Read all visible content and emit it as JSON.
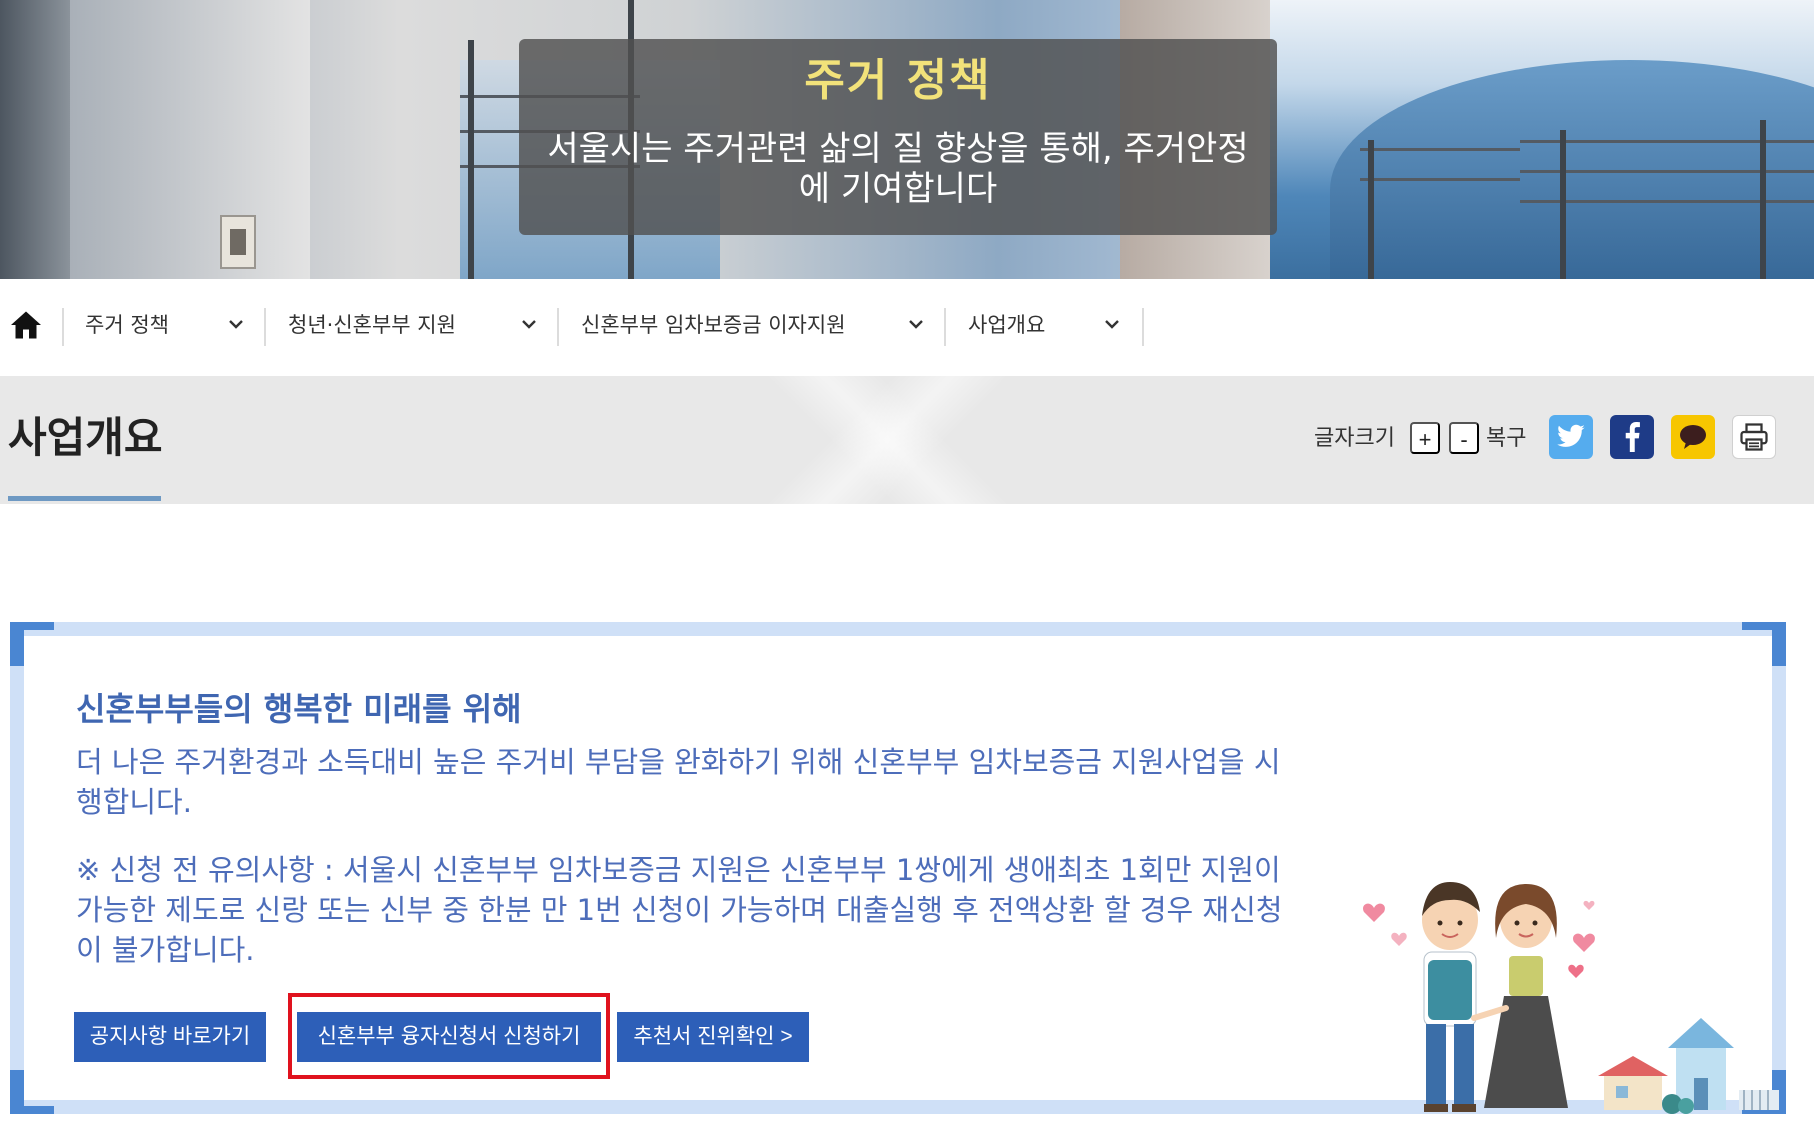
{
  "hero": {
    "title": "주거 정책",
    "description": "서울시는 주거관련 삶의 질 향상을 통해, 주거안정에 기여합니다"
  },
  "breadcrumb": {
    "home_icon": "home-icon",
    "items": [
      {
        "label": "주거 정책"
      },
      {
        "label": "청년·신혼부부 지원"
      },
      {
        "label": "신혼부부 임차보증금 이자지원"
      },
      {
        "label": "사업개요"
      }
    ]
  },
  "page": {
    "title": "사업개요"
  },
  "tools": {
    "font_size_label": "글자크기",
    "increase": "+",
    "decrease": "-",
    "reset": "복구",
    "share": [
      {
        "icon": "twitter-icon",
        "color": "#55acee"
      },
      {
        "icon": "facebook-icon",
        "color": "#1e3b87"
      },
      {
        "icon": "kakaotalk-icon",
        "color": "#f7c600"
      },
      {
        "icon": "print-icon",
        "color": "#ffffff"
      }
    ]
  },
  "content": {
    "heading": "신혼부부들의 행복한 미래를 위해",
    "body": "더 나은 주거환경과 소득대비 높은 주거비 부담을 완화하기 위해 신혼부부 임차보증금 지원사업을 시행합니다.",
    "notice": "※ 신청 전 유의사항 : 서울시 신혼부부 임차보증금 지원은 신혼부부 1쌍에게 생애최초 1회만 지원이 가능한 제도로 신랑 또는 신부 중 한분 만 1번 신청이 가능하며 대출실행 후 전액상환 할 경우 재신청이 불가합니다.",
    "buttons": {
      "notice_link": "공지사항 바로가기",
      "apply": "신혼부부 융자신청서 신청하기",
      "verify": "추천서 진위확인 >"
    }
  },
  "colors": {
    "accent_blue": "#2d5fb8",
    "text_blue": "#4d6dba",
    "box_border": "#cfe0f7",
    "corner_blue": "#4a86d2",
    "highlight_red": "#e0121e",
    "hero_title": "#f2e27a"
  }
}
